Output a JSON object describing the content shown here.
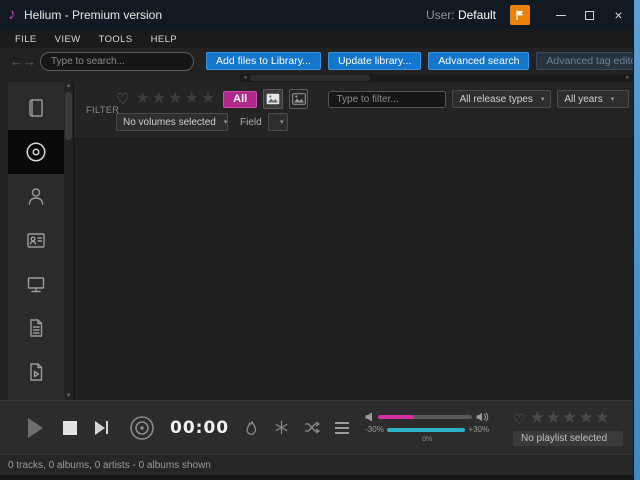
{
  "window": {
    "title": "Helium - Premium version",
    "user_label": "User:",
    "user_value": "Default"
  },
  "menu": {
    "items": [
      "FILE",
      "VIEW",
      "TOOLS",
      "HELP"
    ]
  },
  "toolbar": {
    "search_placeholder": "Type to search...",
    "buttons": [
      {
        "label": "Add files to Library...",
        "enabled": true
      },
      {
        "label": "Update library...",
        "enabled": true
      },
      {
        "label": "Advanced search",
        "enabled": true
      },
      {
        "label": "Advanced tag editor",
        "enabled": false
      }
    ]
  },
  "sidebar": {
    "items": [
      {
        "icon": "library-book",
        "selected": false
      },
      {
        "icon": "album-disc",
        "selected": true
      },
      {
        "icon": "artist-person",
        "selected": false
      },
      {
        "icon": "contact-card",
        "selected": false
      },
      {
        "icon": "device-monitor",
        "selected": false
      },
      {
        "icon": "report-document",
        "selected": false
      },
      {
        "icon": "playlist-document",
        "selected": false
      }
    ]
  },
  "filter": {
    "section_label": "FILTER",
    "rating_stars": 5,
    "all_button": "All",
    "filter_placeholder": "Type to filter...",
    "release_type_value": "All release types",
    "year_value": "All years",
    "volumes_value": "No volumes selected",
    "field_label": "Field"
  },
  "player": {
    "time": "00:00",
    "volume_percent": 38,
    "tempo_min_label": "-30%",
    "tempo_max_label": "+30%",
    "tempo_value_label": "0%",
    "playlist_status": "No playlist selected",
    "playlist_rating_stars": 5
  },
  "status_bar": {
    "text": "0 tracks, 0 albums, 0 artists - 0 albums shown"
  },
  "icons": {
    "app_note": "♪",
    "back": "←",
    "forward": "→",
    "heart": "♡",
    "star": "★",
    "caret": "▾",
    "scroll_up": "▲",
    "scroll_down": "▼",
    "scroll_left": "◄",
    "scroll_right": "►",
    "close": "×"
  },
  "colors": {
    "accent_blue": "#1475cd",
    "accent_magenta": "#b2298c",
    "volume_magenta": "#d32fa2",
    "tempo_cyan": "#2bb3c4",
    "flag_orange": "#e8820c",
    "titlebar": "#131922"
  }
}
